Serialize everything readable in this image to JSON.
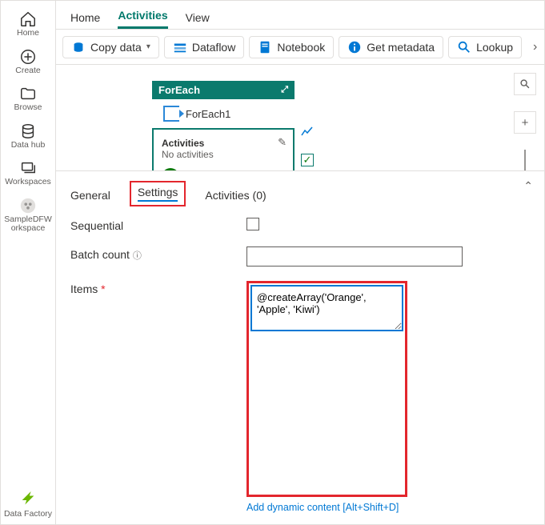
{
  "rail": {
    "home": "Home",
    "create": "Create",
    "browse": "Browse",
    "datahub": "Data hub",
    "workspaces": "Workspaces",
    "sample": "SampleDFW orkspace",
    "datafactory": "Data Factory"
  },
  "tabs": {
    "home": "Home",
    "activities": "Activities",
    "view": "View"
  },
  "toolbar": {
    "copydata": "Copy data",
    "dataflow": "Dataflow",
    "notebook": "Notebook",
    "getmeta": "Get metadata",
    "lookup": "Lookup"
  },
  "activity": {
    "header": "ForEach",
    "name": "ForEach1",
    "section": "Activities",
    "empty": "No activities"
  },
  "panel": {
    "general": "General",
    "settings": "Settings",
    "activities": "Activities (0)",
    "sequential": "Sequential",
    "batchcount": "Batch count",
    "items": "Items",
    "itemsValue": "@createArray('Orange', 'Apple', 'Kiwi')",
    "dynamic": "Add dynamic content [Alt+Shift+D]"
  }
}
